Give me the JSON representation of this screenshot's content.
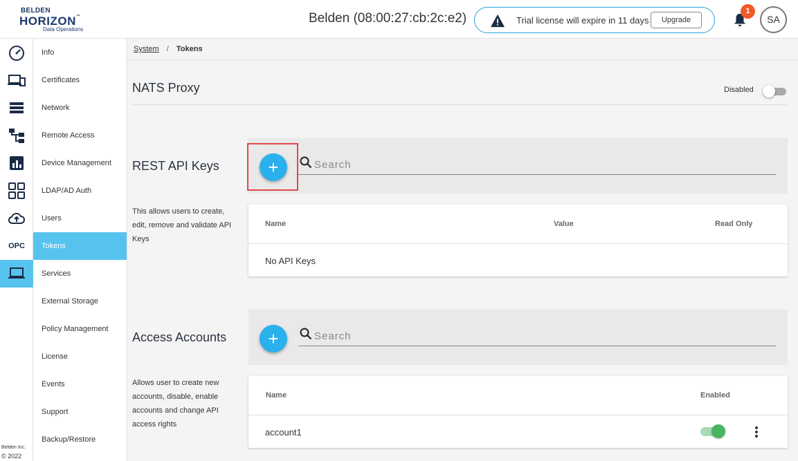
{
  "header": {
    "logo": {
      "line1": "BELDEN",
      "line2": "HORIZON",
      "trademark": "™",
      "line3": "Data Operations"
    },
    "device_title": "Belden (08:00:27:cb:2c:e2)",
    "trial_text": "Trial license will expire in 11 days",
    "upgrade_label": "Upgrade",
    "notification_count": "1",
    "avatar_initials": "SA"
  },
  "rail": {
    "icons": [
      "dashboard-icon",
      "devices-icon",
      "list-icon",
      "hierarchy-icon",
      "analytics-icon",
      "apps-grid-icon",
      "cloud-upload-icon",
      "opc-icon",
      "laptop-icon"
    ],
    "opc_label": "OPC",
    "footer_company": "Belden Inc.",
    "footer_year": "© 2022"
  },
  "subnav": {
    "items": [
      {
        "label": "Info"
      },
      {
        "label": "Certificates"
      },
      {
        "label": "Network"
      },
      {
        "label": "Remote Access"
      },
      {
        "label": "Device Management"
      },
      {
        "label": "LDAP/AD Auth"
      },
      {
        "label": "Users"
      },
      {
        "label": "Tokens"
      },
      {
        "label": "Services"
      },
      {
        "label": "External Storage"
      },
      {
        "label": "Policy Management"
      },
      {
        "label": "License"
      },
      {
        "label": "Events"
      },
      {
        "label": "Support"
      },
      {
        "label": "Backup/Restore"
      }
    ],
    "active": "Tokens"
  },
  "breadcrumb": {
    "root": "System",
    "separator": "/",
    "current": "Tokens"
  },
  "nats": {
    "title": "NATS Proxy",
    "toggle_label": "Disabled"
  },
  "rest_api": {
    "title": "REST API Keys",
    "description": "This allows users to create, edit, remove and validate API Keys",
    "add_symbol": "+",
    "search_placeholder": "Search",
    "columns": {
      "name": "Name",
      "value": "Value",
      "read_only": "Read Only"
    },
    "empty_text": "No API Keys"
  },
  "access": {
    "title": "Access Accounts",
    "description": "Allows user to create new accounts, disable, enable accounts and change API access rights",
    "add_symbol": "+",
    "search_placeholder": "Search",
    "columns": {
      "name": "Name",
      "enabled": "Enabled"
    },
    "rows": [
      {
        "name": "account1",
        "enabled": true
      }
    ]
  },
  "colors": {
    "accent": "#56c3ee",
    "add_button": "#2ab0ec",
    "badge": "#f05a28",
    "enabled_toggle": "#48b560",
    "highlight": "#e0474c",
    "brand": "#1b3a6b"
  }
}
